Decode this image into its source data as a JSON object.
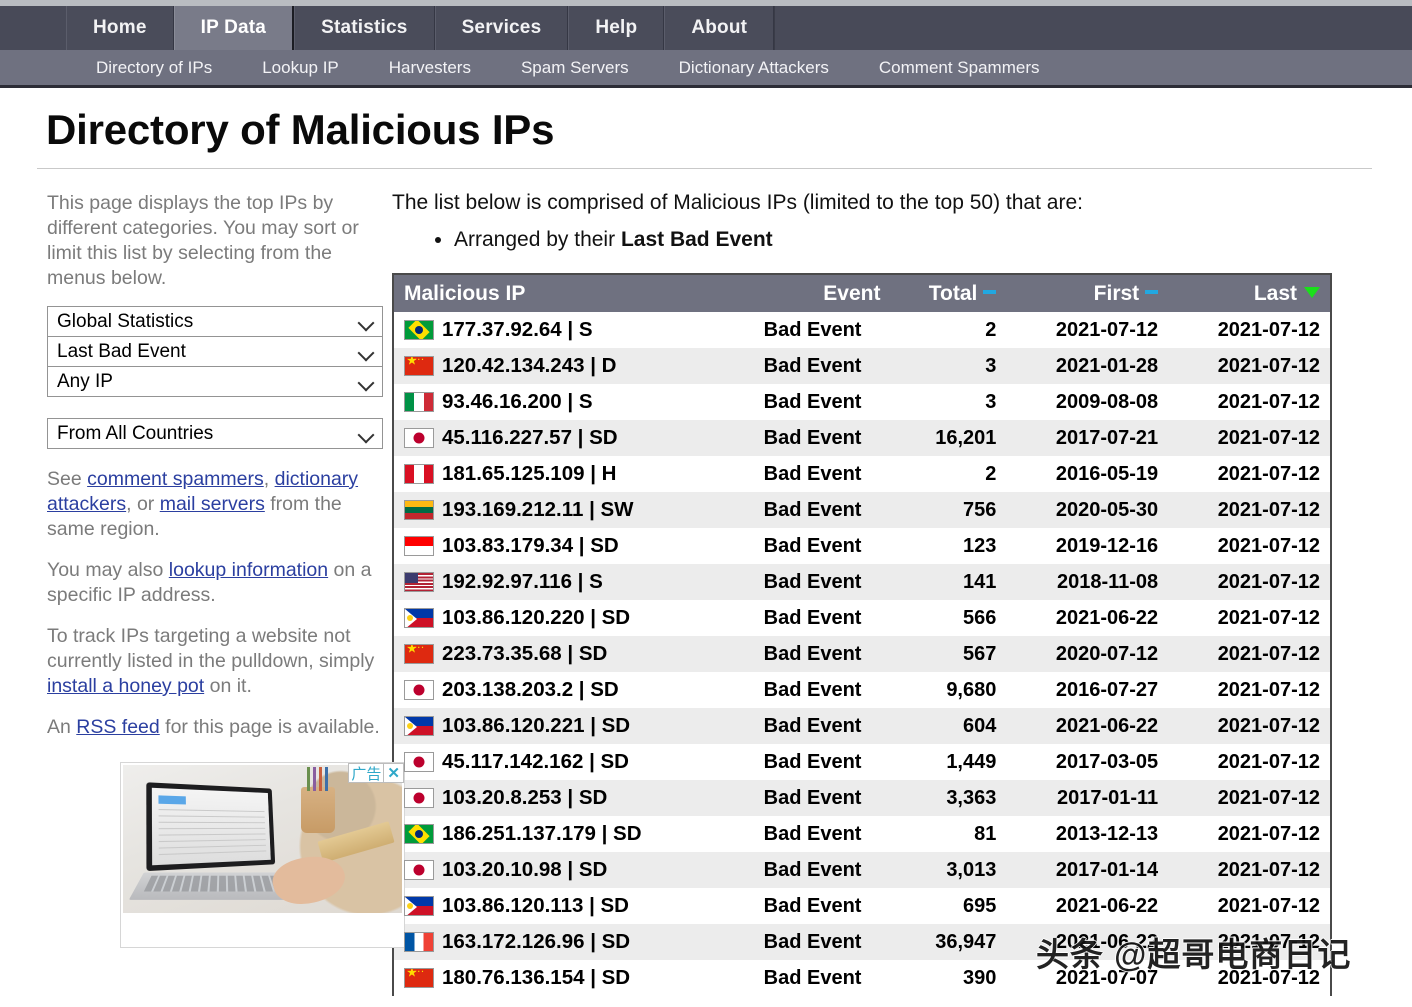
{
  "nav": {
    "primary": [
      {
        "label": "Home",
        "active": false
      },
      {
        "label": "IP Data",
        "active": true
      },
      {
        "label": "Statistics",
        "active": false
      },
      {
        "label": "Services",
        "active": false
      },
      {
        "label": "Help",
        "active": false
      },
      {
        "label": "About",
        "active": false
      }
    ],
    "secondary": [
      {
        "label": "Directory of IPs"
      },
      {
        "label": "Lookup IP"
      },
      {
        "label": "Harvesters"
      },
      {
        "label": "Spam Servers"
      },
      {
        "label": "Dictionary Attackers"
      },
      {
        "label": "Comment Spammers"
      }
    ]
  },
  "page": {
    "title": "Directory of Malicious IPs"
  },
  "sidebar": {
    "intro": "This page displays the top IPs by different categories. You may sort or limit this list by selecting from the menus below.",
    "selects": [
      {
        "name": "statistics-scope",
        "value": "Global Statistics"
      },
      {
        "name": "sort-order",
        "value": "Last Bad Event"
      },
      {
        "name": "ip-type",
        "value": "Any IP"
      },
      {
        "name": "country-filter",
        "value": "From All Countries"
      }
    ],
    "para_see": {
      "prefix": "See ",
      "link1": "comment spammers",
      "sep1": ", ",
      "link2": "dictionary attackers",
      "sep2": ", or ",
      "link3": "mail servers",
      "suffix": " from the same region."
    },
    "para_lookup": {
      "prefix": "You may also ",
      "link": "lookup information",
      "suffix": " on a specific IP address."
    },
    "para_track": {
      "prefix": "To track IPs targeting a website not currently listed in the pulldown, simply ",
      "link": "install a honey pot",
      "suffix": " on it."
    },
    "para_rss": {
      "prefix": "An ",
      "link": "RSS feed",
      "suffix": " for this page is available."
    }
  },
  "ad": {
    "label": "广告",
    "close": "✕"
  },
  "main": {
    "intro": "The list below is comprised of Malicious IPs (limited to the top 50) that are:",
    "bullet_prefix": "Arranged by their ",
    "bullet_strong": "Last Bad Event"
  },
  "table": {
    "columns": [
      {
        "key": "ip",
        "label": "Malicious IP",
        "sort": "none"
      },
      {
        "key": "event",
        "label": "Event",
        "sort": "none"
      },
      {
        "key": "total",
        "label": "Total",
        "sort": "dash"
      },
      {
        "key": "first",
        "label": "First",
        "sort": "dash"
      },
      {
        "key": "last",
        "label": "Last",
        "sort": "desc"
      }
    ],
    "sort_colors": {
      "dash": "#22a8e0",
      "caret": "#1ae01a"
    },
    "rows": [
      {
        "flag": "br",
        "ip": "177.37.92.64 | S",
        "event": "Bad Event",
        "total": "2",
        "first": "2021-07-12",
        "last": "2021-07-12"
      },
      {
        "flag": "cn",
        "ip": "120.42.134.243 | D",
        "event": "Bad Event",
        "total": "3",
        "first": "2021-01-28",
        "last": "2021-07-12"
      },
      {
        "flag": "it",
        "ip": "93.46.16.200 | S",
        "event": "Bad Event",
        "total": "3",
        "first": "2009-08-08",
        "last": "2021-07-12"
      },
      {
        "flag": "jp",
        "ip": "45.116.227.57 | SD",
        "event": "Bad Event",
        "total": "16,201",
        "first": "2017-07-21",
        "last": "2021-07-12"
      },
      {
        "flag": "pe",
        "ip": "181.65.125.109 | H",
        "event": "Bad Event",
        "total": "2",
        "first": "2016-05-19",
        "last": "2021-07-12"
      },
      {
        "flag": "lt",
        "ip": "193.169.212.11 | SW",
        "event": "Bad Event",
        "total": "756",
        "first": "2020-05-30",
        "last": "2021-07-12"
      },
      {
        "flag": "id",
        "ip": "103.83.179.34 | SD",
        "event": "Bad Event",
        "total": "123",
        "first": "2019-12-16",
        "last": "2021-07-12"
      },
      {
        "flag": "us",
        "ip": "192.92.97.116 | S",
        "event": "Bad Event",
        "total": "141",
        "first": "2018-11-08",
        "last": "2021-07-12"
      },
      {
        "flag": "ph",
        "ip": "103.86.120.220 | SD",
        "event": "Bad Event",
        "total": "566",
        "first": "2021-06-22",
        "last": "2021-07-12"
      },
      {
        "flag": "cn",
        "ip": "223.73.35.68 | SD",
        "event": "Bad Event",
        "total": "567",
        "first": "2020-07-12",
        "last": "2021-07-12"
      },
      {
        "flag": "jp",
        "ip": "203.138.203.2 | SD",
        "event": "Bad Event",
        "total": "9,680",
        "first": "2016-07-27",
        "last": "2021-07-12"
      },
      {
        "flag": "ph",
        "ip": "103.86.120.221 | SD",
        "event": "Bad Event",
        "total": "604",
        "first": "2021-06-22",
        "last": "2021-07-12"
      },
      {
        "flag": "jp",
        "ip": "45.117.142.162 | SD",
        "event": "Bad Event",
        "total": "1,449",
        "first": "2017-03-05",
        "last": "2021-07-12"
      },
      {
        "flag": "jp",
        "ip": "103.20.8.253 | SD",
        "event": "Bad Event",
        "total": "3,363",
        "first": "2017-01-11",
        "last": "2021-07-12"
      },
      {
        "flag": "br",
        "ip": "186.251.137.179 | SD",
        "event": "Bad Event",
        "total": "81",
        "first": "2013-12-13",
        "last": "2021-07-12"
      },
      {
        "flag": "jp",
        "ip": "103.20.10.98 | SD",
        "event": "Bad Event",
        "total": "3,013",
        "first": "2017-01-14",
        "last": "2021-07-12"
      },
      {
        "flag": "ph",
        "ip": "103.86.120.113 | SD",
        "event": "Bad Event",
        "total": "695",
        "first": "2021-06-22",
        "last": "2021-07-12"
      },
      {
        "flag": "fr",
        "ip": "163.172.126.96 | SD",
        "event": "Bad Event",
        "total": "36,947",
        "first": "2021-06-22",
        "last": "2021-07-12"
      },
      {
        "flag": "cn",
        "ip": "180.76.136.154 | SD",
        "event": "Bad Event",
        "total": "390",
        "first": "2021-07-07",
        "last": "2021-07-12"
      }
    ]
  },
  "watermark": {
    "text": "头条 @超哥电商日记"
  }
}
